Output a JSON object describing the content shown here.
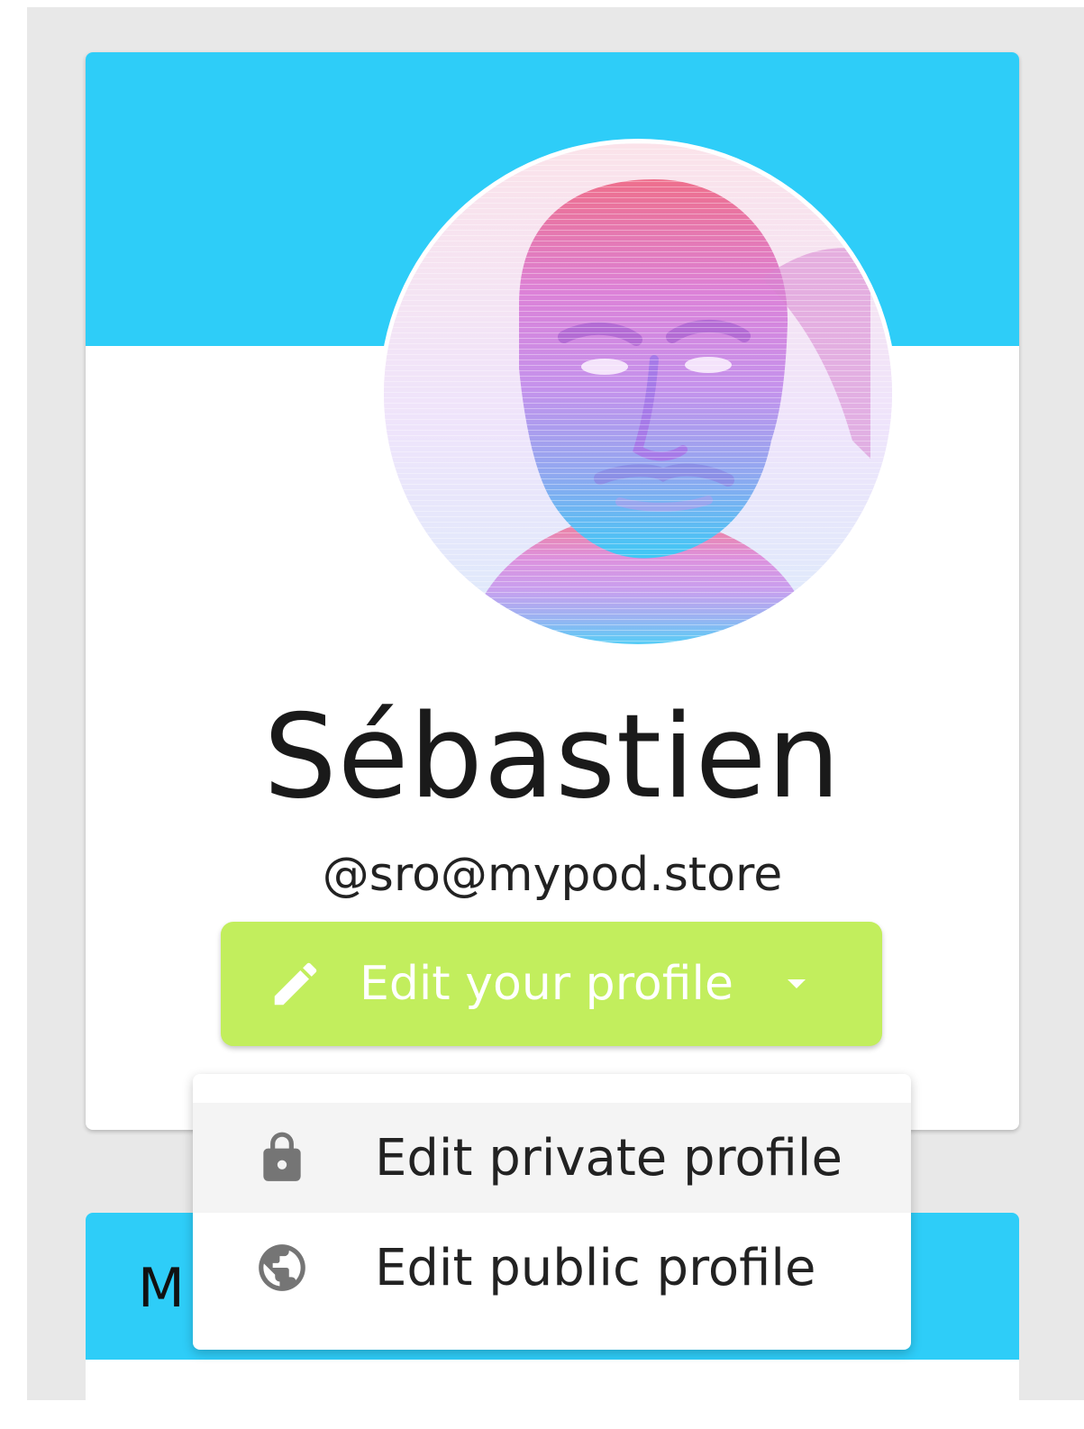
{
  "profile": {
    "name": "Sébastien",
    "handle": "@sro@mypod.store",
    "avatar_icon": "profile-portrait"
  },
  "edit_button": {
    "label": "Edit your profile",
    "icon": "pencil-icon",
    "caret_icon": "caret-down-icon"
  },
  "dropdown": {
    "items": [
      {
        "label": "Edit private profile",
        "icon": "lock-icon",
        "highlighted": true
      },
      {
        "label": "Edit public profile",
        "icon": "globe-icon",
        "highlighted": false
      }
    ]
  },
  "second_card": {
    "title_visible_fragment": "M"
  },
  "colors": {
    "banner": "#2ecdf8",
    "button": "#c2ee5d",
    "page_background": "#e8e8e8",
    "card_background": "#ffffff",
    "menu_hover": "#f4f4f4"
  }
}
